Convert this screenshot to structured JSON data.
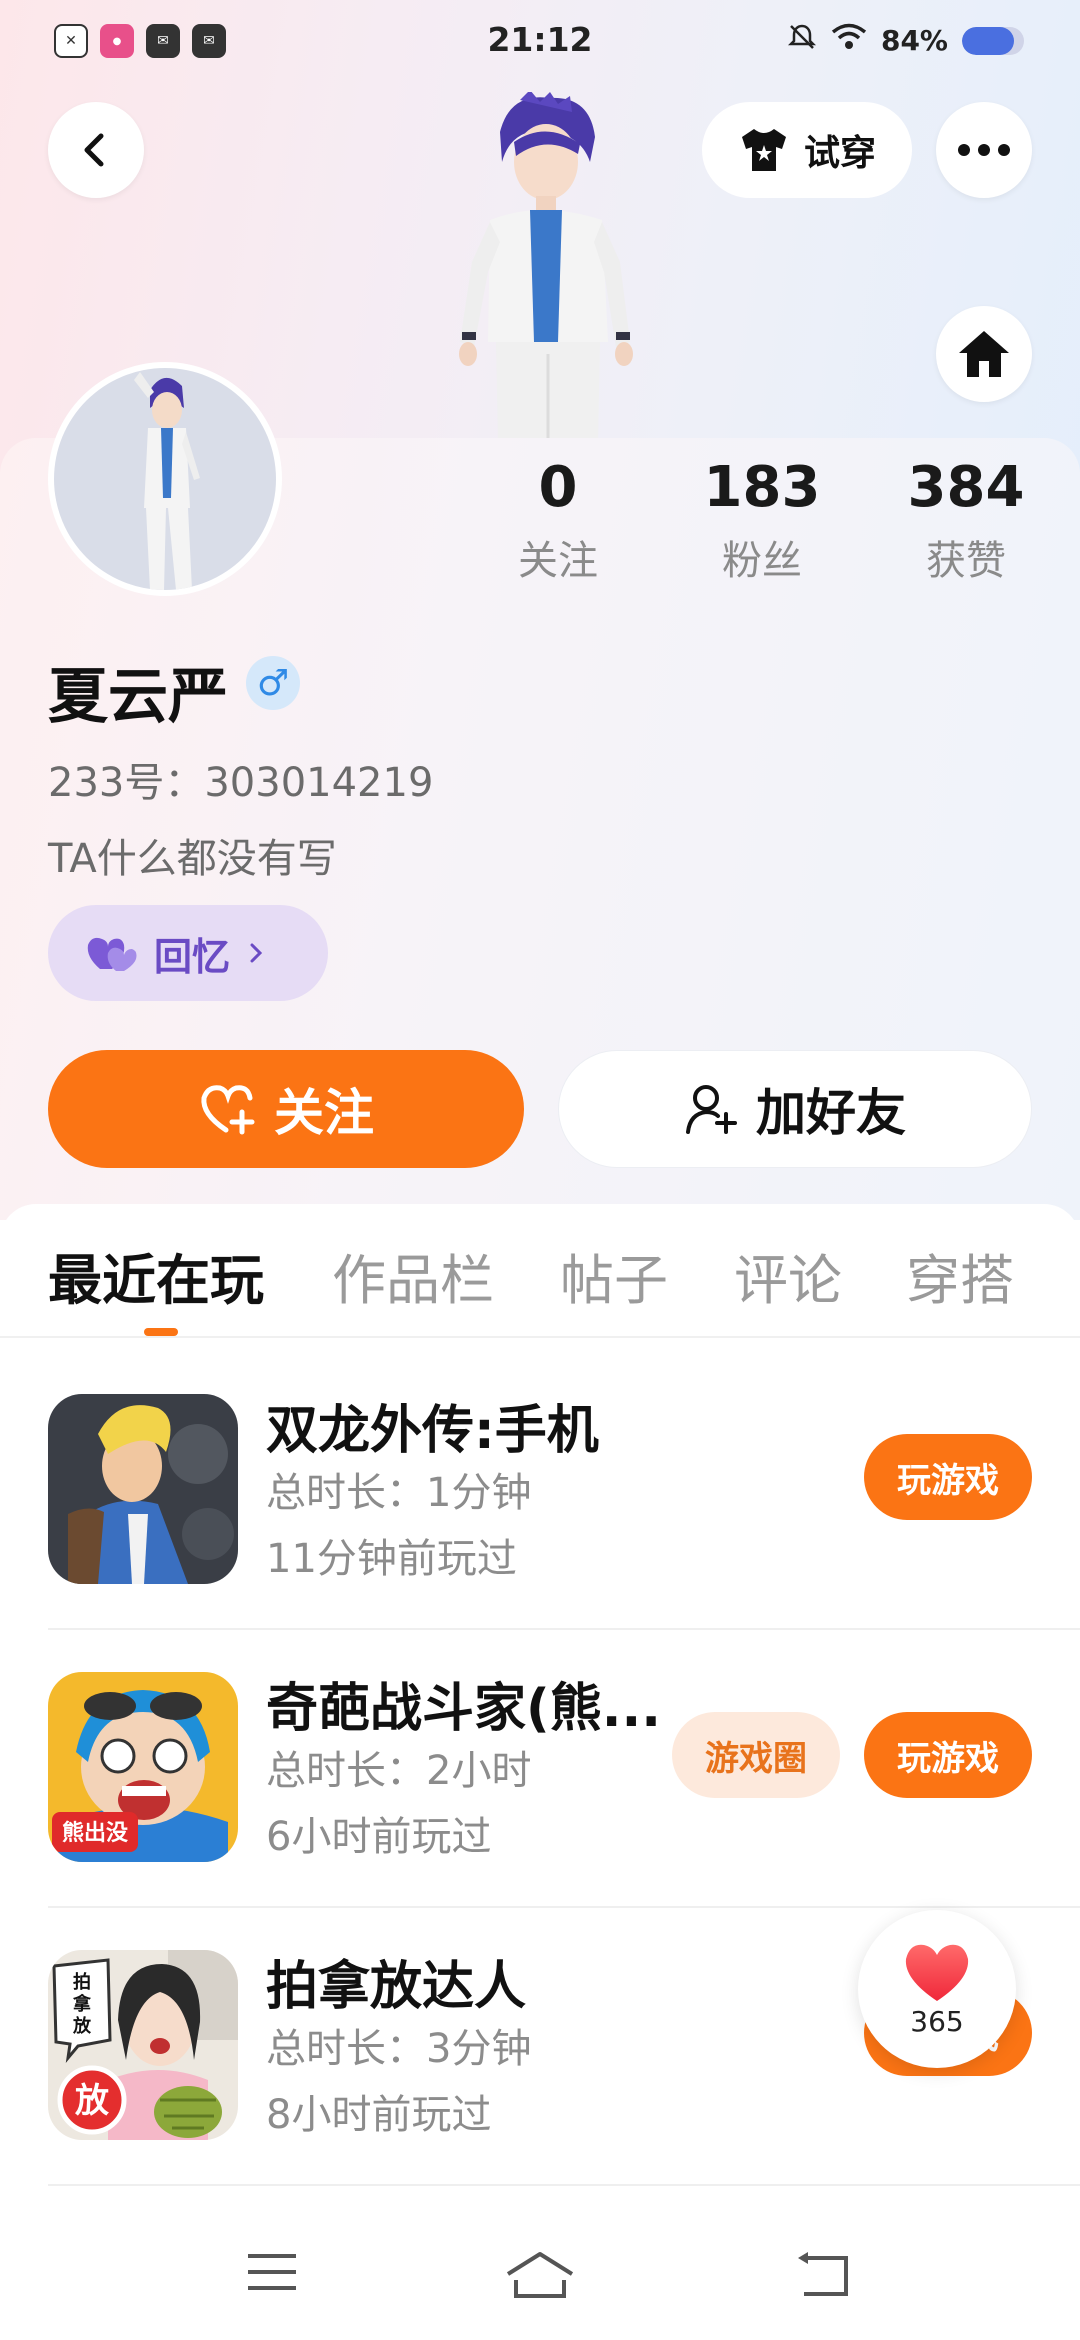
{
  "status_bar": {
    "time": "21:12",
    "battery": "84%",
    "battery_level": 0.84,
    "left_icons": [
      "doc-x-icon",
      "app-pink-icon",
      "mail-icon",
      "mail-icon"
    ]
  },
  "header": {
    "try_on_label": "试穿"
  },
  "profile": {
    "name": "夏云严",
    "gender_symbol": "♂",
    "uid": "233号：303014219",
    "bio": "TA什么都没有写",
    "memory_label": "回忆",
    "stats": [
      {
        "value": "0",
        "label": "关注"
      },
      {
        "value": "183",
        "label": "粉丝"
      },
      {
        "value": "384",
        "label": "获赞"
      }
    ]
  },
  "actions": {
    "follow_label": "关注",
    "add_friend_label": "加好友"
  },
  "tabs": [
    {
      "label": "最近在玩",
      "active": true
    },
    {
      "label": "作品栏",
      "active": false
    },
    {
      "label": "帖子",
      "active": false
    },
    {
      "label": "评论",
      "active": false
    },
    {
      "label": "穿搭",
      "active": false
    }
  ],
  "games": [
    {
      "title": "双龙外传:手机",
      "duration": "总时长：1分钟",
      "last_played": "11分钟前玩过",
      "play_label": "玩游戏",
      "circle_label": ""
    },
    {
      "title": "奇葩战斗家(熊...",
      "duration": "总时长：2小时",
      "last_played": "6小时前玩过",
      "play_label": "玩游戏",
      "circle_label": "游戏圈"
    },
    {
      "title": "拍拿放达人",
      "duration": "总时长：3分钟",
      "last_played": "8小时前玩过",
      "play_label": "玩游戏",
      "circle_label": ""
    }
  ],
  "game_icon_text": {
    "game2_badge": "熊出没",
    "game3_bubble": "拍\n拿\n放",
    "game3_badge": "放"
  },
  "like_float": {
    "count": "365"
  },
  "colors": {
    "accent": "#fb7414",
    "memory_bg": "#e6dcf5",
    "memory_text": "#6a4bc4",
    "gender_blue": "#2f8ae6"
  }
}
